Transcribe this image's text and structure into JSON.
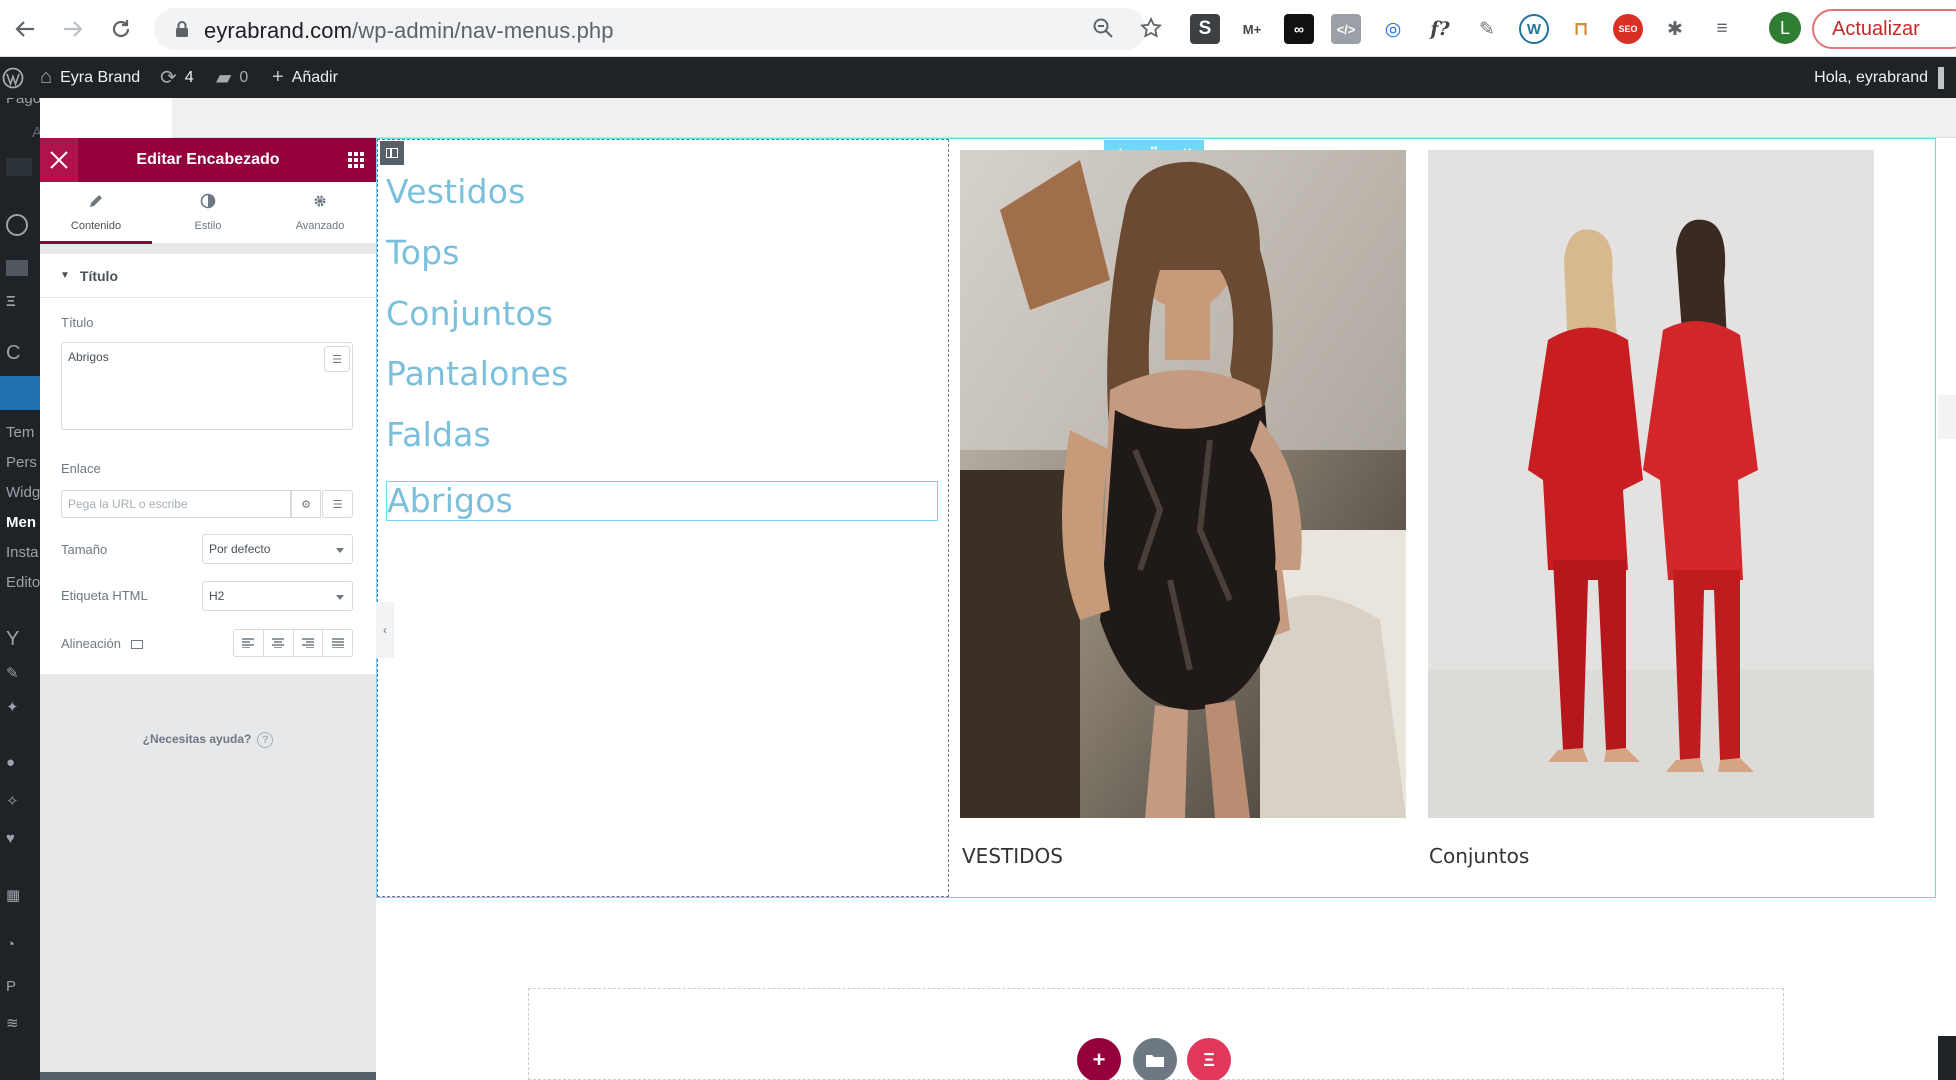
{
  "browser": {
    "url_host": "eyrabrand.com",
    "url_path": "/wp-admin/nav-menus.php",
    "avatar_letter": "L",
    "update_label": "Actualizar",
    "extensions": [
      "S",
      "M+",
      "∞",
      "</>",
      "◎",
      "f?",
      "✎",
      "W",
      "⊓",
      "SEO",
      "✱",
      "≡"
    ]
  },
  "adminbar": {
    "site_name": "Eyra Brand",
    "updates_count": "4",
    "comments_count": "0",
    "add_label": "Añadir",
    "greeting": "Hola, eyrabrand"
  },
  "wp_sidebar": {
    "items": [
      "Pagos",
      "Análisis",
      "Tem",
      "Pers",
      "Widg",
      "Men",
      "Insta",
      "Edito"
    ]
  },
  "panel": {
    "title": "Editar Encabezado",
    "tabs": [
      {
        "label": "Contenido",
        "icon": "pencil-icon"
      },
      {
        "label": "Estilo",
        "icon": "contrast-icon"
      },
      {
        "label": "Avanzado",
        "icon": "gear-icon"
      }
    ],
    "section_title": "Título",
    "title_label": "Título",
    "title_value": "Abrigos",
    "link_label": "Enlace",
    "link_placeholder": "Pega la URL o escribe",
    "size_label": "Tamaño",
    "size_value": "Por defecto",
    "html_tag_label": "Etiqueta HTML",
    "html_tag_value": "H2",
    "alignment_label": "Alineación",
    "help_text": "¿Necesitas ayuda?"
  },
  "canvas": {
    "menu_items": [
      "Vestidos",
      "Tops",
      "Conjuntos",
      "Pantalones",
      "Faldas",
      "Abrigos"
    ],
    "captions": [
      "VESTIDOS",
      "Conjuntos"
    ]
  },
  "colors": {
    "elementor_maroon": "#93003c",
    "menu_link": "#7ac0dc",
    "selection": "#71d7f7",
    "wp_dark": "#1d2327"
  }
}
